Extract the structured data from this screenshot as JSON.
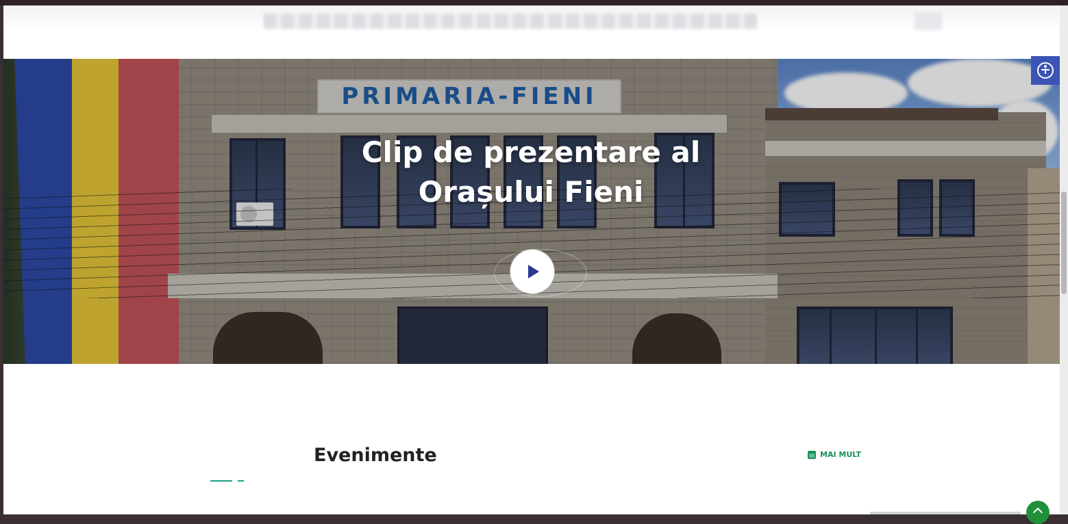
{
  "hero": {
    "sign_text": "PRIMARIA-FIENI",
    "title_line1": "Clip de prezentare al",
    "title_line2": "Orașului Fieni",
    "play_icon": "play-icon"
  },
  "accessibility": {
    "icon": "accessibility-icon",
    "color": "#3b55b4"
  },
  "events": {
    "title": "Evenimente",
    "more_label": "MAI MULT",
    "more_icon": "calendar-icon",
    "accent_color": "#1aa086"
  },
  "back_to_top": {
    "icon": "chevron-up-icon",
    "color": "#1f8f3a"
  }
}
